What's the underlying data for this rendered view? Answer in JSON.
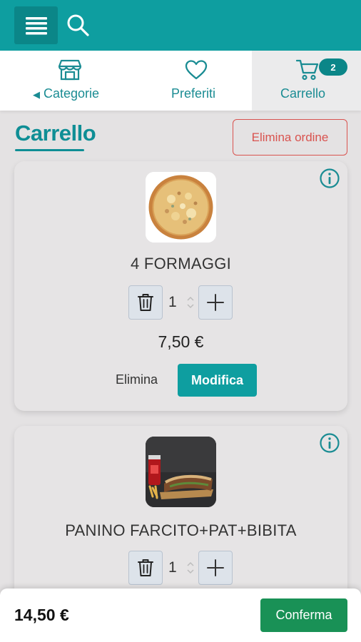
{
  "header": {
    "menu_icon": "hamburger-icon",
    "search_icon": "search-icon",
    "brand_color": "#0e9ea0"
  },
  "nav": {
    "categories_label": "Categorie",
    "favorites_label": "Preferiti",
    "cart_label": "Carrello",
    "cart_count": "2"
  },
  "page": {
    "title": "Carrello",
    "delete_order_label": "Elimina ordine"
  },
  "cart_items": [
    {
      "name": "4 FORMAGGI",
      "quantity": "1",
      "price": "7,50 €",
      "remove_label": "Elimina",
      "edit_label": "Modifica"
    },
    {
      "name": "PANINO FARCITO+PAT+BIBITA",
      "quantity": "1"
    }
  ],
  "footer": {
    "total": "14,50 €",
    "confirm_label": "Conferma",
    "confirm_color": "#199156"
  }
}
